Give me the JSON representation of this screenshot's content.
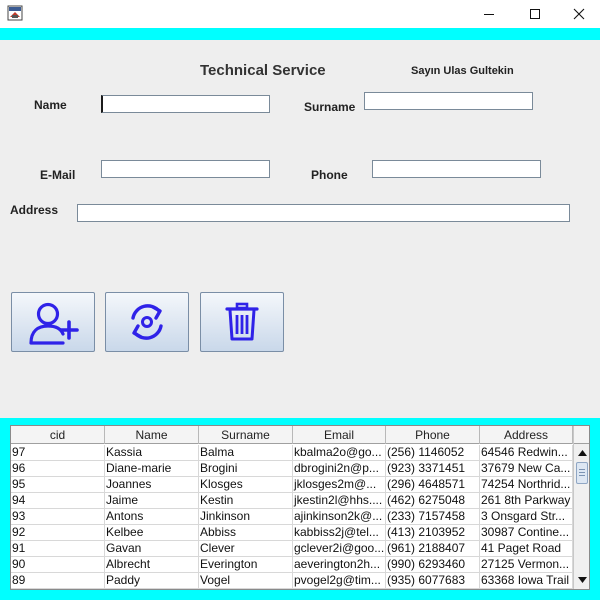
{
  "form": {
    "heading": "Technical Service",
    "greeting": "Sayın Ulas Gultekin",
    "name_label": "Name",
    "surname_label": "Surname",
    "email_label": "E-Mail",
    "phone_label": "Phone",
    "address_label": "Address",
    "name_value": "",
    "surname_value": "",
    "email_value": "",
    "phone_value": "",
    "address_value": ""
  },
  "buttons": {
    "add_icon": "add-user-icon",
    "refresh_icon": "refresh-icon",
    "delete_icon": "trash-icon",
    "icon_color": "#2f22e8"
  },
  "table": {
    "columns": [
      "cid",
      "Name",
      "Surname",
      "Email",
      "Phone",
      "Address"
    ],
    "rows": [
      [
        "97",
        "Kassia",
        "Balma",
        "kbalma2o@go...",
        "(256) 1146052",
        "64546 Redwin..."
      ],
      [
        "96",
        "Diane-marie",
        "Brogini",
        "dbrogini2n@p...",
        "(923) 3371451",
        "37679 New Ca..."
      ],
      [
        "95",
        "Joannes",
        "Klosges",
        "jklosges2m@...",
        "(296) 4648571",
        "74254 Northrid..."
      ],
      [
        "94",
        "Jaime",
        "Kestin",
        "jkestin2l@hhs....",
        "(462) 6275048",
        "261 8th Parkway"
      ],
      [
        "93",
        "Antons",
        "Jinkinson",
        "ajinkinson2k@...",
        "(233) 7157458",
        "3 Onsgard Str..."
      ],
      [
        "92",
        "Kelbee",
        "Abbiss",
        "kabbiss2j@tel...",
        "(413) 2103952",
        "30987 Contine..."
      ],
      [
        "91",
        "Gavan",
        "Clever",
        "gclever2i@goo...",
        "(961) 2188407",
        "41 Paget Road"
      ],
      [
        "90",
        "Albrecht",
        "Everington",
        "aeverington2h...",
        "(990) 6293460",
        "27125 Vermon..."
      ],
      [
        "89",
        "Paddy",
        "Vogel",
        "pvogel2g@tim...",
        "(935) 6077683",
        "63368 Iowa Trail"
      ]
    ]
  },
  "colors": {
    "accent_cyan": "#00ffff",
    "panel_bg": "#eeeeee"
  }
}
